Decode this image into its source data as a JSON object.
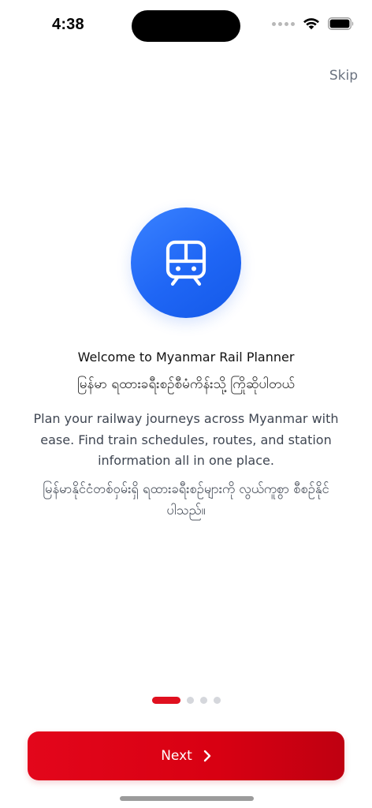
{
  "status_bar": {
    "time": "4:38",
    "icons": [
      "cellular-dots-icon",
      "wifi-icon",
      "battery-icon"
    ]
  },
  "skip_label": "Skip",
  "hero": {
    "icon": "train-icon",
    "color": "#1F66F5"
  },
  "title_en": "Welcome to Myanmar Rail Planner",
  "title_my": "မြန်မာ ရထားခရီးစဉ်စီမံကိန်းသို့ ကြိုဆိုပါတယ်",
  "description_en": "Plan your railway journeys across Myanmar with ease. Find train schedules, routes, and station information all in one place.",
  "description_my": "မြန်မာနိုင်ငံတစ်ဝှမ်းရှိ ရထားခရီးစဉ်များကို လွယ်ကူစွာ စီစဉ်နိုင်ပါသည်။",
  "pagination": {
    "total": 4,
    "current": 1,
    "active_color": "#E0101F"
  },
  "next_button": {
    "label": "Next",
    "icon": "chevron-right-icon",
    "color": "#D80012"
  }
}
